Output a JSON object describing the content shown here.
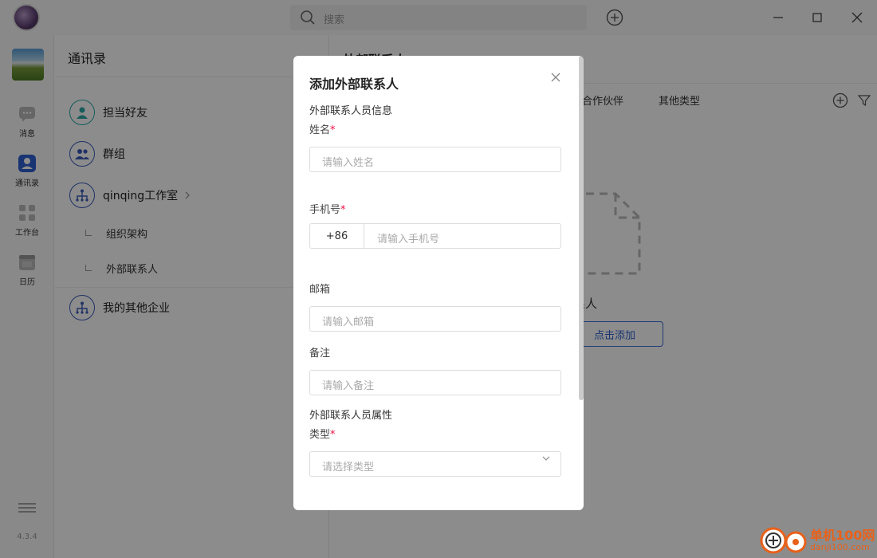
{
  "titlebar": {
    "search_placeholder": "搜索"
  },
  "rail": {
    "items": [
      {
        "label": "消息"
      },
      {
        "label": "通讯录"
      },
      {
        "label": "工作台"
      },
      {
        "label": "日历"
      }
    ],
    "version": "4.3.4"
  },
  "contacts": {
    "title": "通讯录",
    "items": [
      {
        "label": "担当好友"
      },
      {
        "label": "群组"
      },
      {
        "label": "qinqing工作室"
      },
      {
        "label": "我的其他企业"
      }
    ],
    "sub_items": [
      {
        "label": "组织架构"
      },
      {
        "label": "外部联系人"
      }
    ]
  },
  "main": {
    "title": "外部联系人",
    "tabs": [
      {
        "label": "合作伙伴"
      },
      {
        "label": "其他类型"
      }
    ],
    "empty_text": "加的外部联系人",
    "empty_button": "点击添加"
  },
  "dialog": {
    "title": "添加外部联系人",
    "section_info": "外部联系人员信息",
    "name_label": "姓名",
    "name_placeholder": "请输入姓名",
    "phone_label": "手机号",
    "country_code": "+86",
    "phone_placeholder": "请输入手机号",
    "email_label": "邮箱",
    "email_placeholder": "请输入邮箱",
    "note_label": "备注",
    "note_placeholder": "请输入备注",
    "section_attr": "外部联系人员属性",
    "type_label": "类型",
    "type_placeholder": "请选择类型",
    "required_mark": "*"
  },
  "watermark": {
    "brand": "单机100网",
    "url": "danji100.com"
  },
  "colors": {
    "accent": "#3b6fd9",
    "required": "#e11144",
    "watermark": "#e8611a",
    "overlay": "rgba(0,0,0,0.45)"
  }
}
